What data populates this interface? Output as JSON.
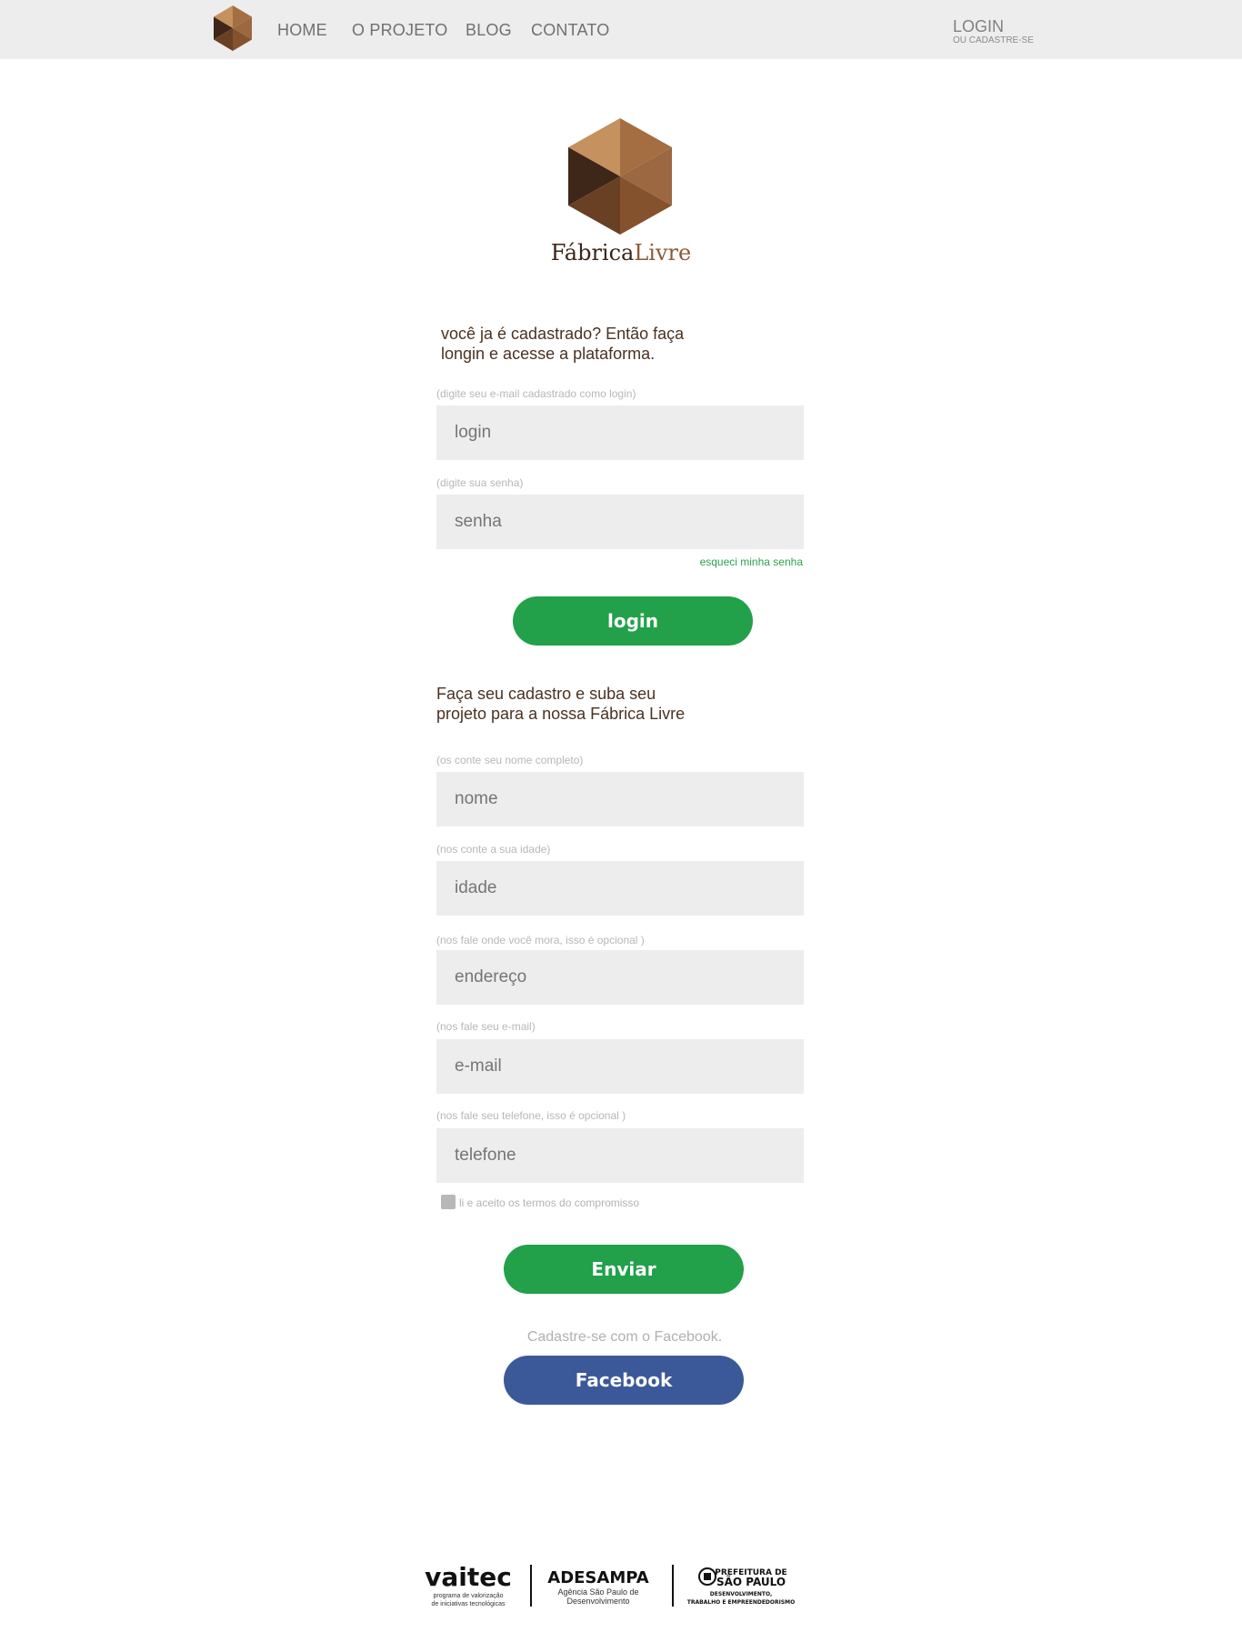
{
  "nav": {
    "items": [
      "HOME",
      "O PROJETO",
      "BLOG",
      "CONTATO"
    ],
    "login": "LOGIN",
    "login_sub": "OU CADASTRE-SE"
  },
  "brand": {
    "name_part1": "Fábrica",
    "name_part2": "Livre"
  },
  "login_section": {
    "intro_line1": "você ja é cadastrado? Então faça",
    "intro_line2": "longin e acesse a plataforma.",
    "login_hint": "(digite seu e-mail cadastrado como login)",
    "login_placeholder": "login",
    "password_hint": "(digite sua senha)",
    "password_placeholder": "senha",
    "forgot": "esqueci minha senha",
    "button": "login"
  },
  "signup_section": {
    "intro_line1": "Faça seu cadastro e suba seu",
    "intro_line2": "projeto para a nossa Fábrica Livre",
    "fields": [
      {
        "hint": "(os conte seu nome completo)",
        "placeholder": "nome"
      },
      {
        "hint": "(nos conte a sua idade)",
        "placeholder": "idade"
      },
      {
        "hint": "(nos fale onde você mora, isso é opcional )",
        "placeholder": "endereço"
      },
      {
        "hint": "(nos fale seu e-mail)",
        "placeholder": "e-mail"
      },
      {
        "hint": "(nos fale seu telefone, isso é opcional )",
        "placeholder": "telefone"
      }
    ],
    "terms": "li e aceito os termos do compromisso",
    "button": "Enviar",
    "facebook_caption": "Cadastre-se com o Facebook.",
    "facebook_button": "Facebook"
  },
  "footer": {
    "vaitec": "vaitec",
    "vaitec_sub1": "programa de valorização",
    "vaitec_sub2": "de iniciativas tecnológicas",
    "adesampa": "ADESAMPA",
    "adesampa_sub1": "Agência São Paulo de",
    "adesampa_sub2": "Desenvolvimento",
    "pref1": "PREFEITURA DE",
    "pref2": "SÃO PAULO",
    "pref3": "DESENVOLVIMENTO,",
    "pref4": "TRABALHO E EMPREENDEDORISMO"
  },
  "colors": {
    "green": "#22a04a",
    "facebook": "#3b5998",
    "brown_dark": "#3b2416",
    "field_bg": "#ededed"
  }
}
